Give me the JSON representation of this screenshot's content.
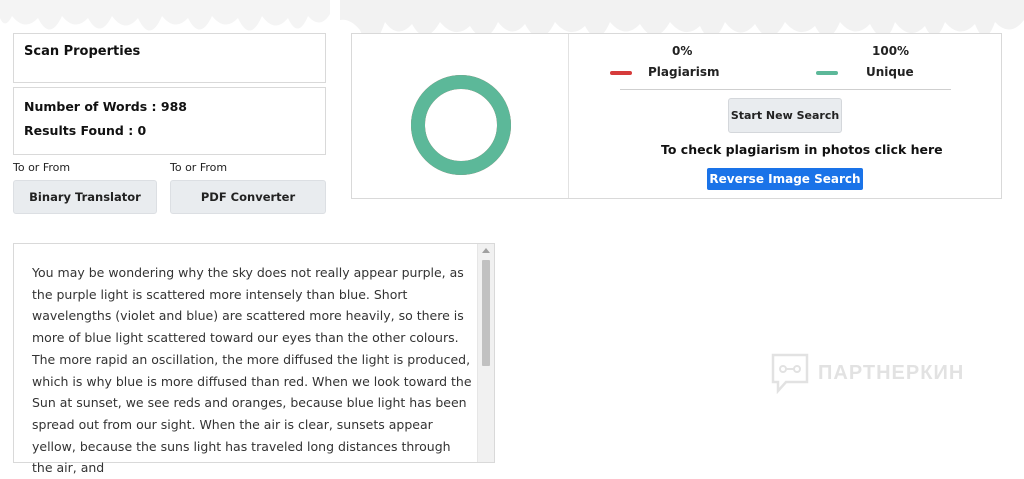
{
  "scan": {
    "title": "Scan Properties",
    "words": "Number of Words : 988",
    "results": "Results Found : 0"
  },
  "tools": {
    "label_left": "To or From",
    "label_right": "To or From",
    "binary_button": "Binary Translator",
    "pdf_button": "PDF Converter"
  },
  "results_panel": {
    "plagiarism_percent": "0%",
    "unique_percent": "100%",
    "plagiarism_label": "Plagiarism",
    "unique_label": "Unique",
    "plagiarism_color": "#d63b3b",
    "unique_color": "#5cb899",
    "unique_fraction": 1.0,
    "start_button": "Start New Search",
    "photo_text": "To check plagiarism in photos click here",
    "reverse_button": "Reverse Image Search"
  },
  "text_content": "You may be wondering why the sky does not really appear purple, as the purple light is scattered more intensely than blue. Short wavelengths (violet and blue) are scattered more heavily, so there is more of blue light scattered toward our eyes than the other colours. The more rapid an oscillation, the more diffused the light is produced, which is why blue is more diffused than red. When we look toward the Sun at sunset, we see reds and oranges, because blue light has been spread out from our sight. When the air is clear, sunsets appear yellow, because the suns light has traveled long distances through the air, and",
  "watermark": {
    "text": "ПАРТНЕРКИН",
    "icon": "chat-bubble-icon"
  }
}
